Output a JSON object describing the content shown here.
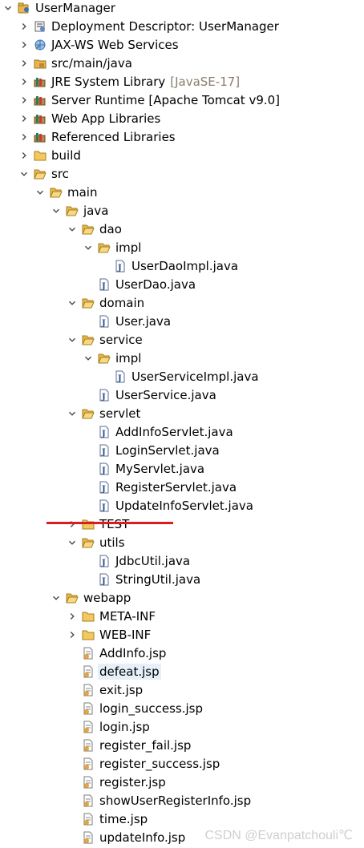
{
  "tree": [
    {
      "label": "UserManager",
      "level": 0,
      "twisty": "expanded",
      "icon": "project-icon"
    },
    {
      "label": "Deployment Descriptor: UserManager",
      "level": 1,
      "twisty": "collapsed",
      "icon": "deployment-descriptor-icon"
    },
    {
      "label": "JAX-WS Web Services",
      "level": 1,
      "twisty": "collapsed",
      "icon": "web-services-icon"
    },
    {
      "label": "src/main/java",
      "level": 1,
      "twisty": "collapsed",
      "icon": "source-folder-icon"
    },
    {
      "label": "JRE System Library",
      "decoration": "[JavaSE-17]",
      "level": 1,
      "twisty": "collapsed",
      "icon": "library-icon"
    },
    {
      "label": "Server Runtime [Apache Tomcat v9.0]",
      "level": 1,
      "twisty": "collapsed",
      "icon": "library-icon"
    },
    {
      "label": "Web App Libraries",
      "level": 1,
      "twisty": "collapsed",
      "icon": "library-icon"
    },
    {
      "label": "Referenced Libraries",
      "level": 1,
      "twisty": "collapsed",
      "icon": "library-icon"
    },
    {
      "label": "build",
      "level": 1,
      "twisty": "collapsed",
      "icon": "folder-icon"
    },
    {
      "label": "src",
      "level": 1,
      "twisty": "expanded",
      "icon": "folder-open-icon"
    },
    {
      "label": "main",
      "level": 2,
      "twisty": "expanded",
      "icon": "folder-open-icon"
    },
    {
      "label": "java",
      "level": 3,
      "twisty": "expanded",
      "icon": "folder-open-icon"
    },
    {
      "label": "dao",
      "level": 4,
      "twisty": "expanded",
      "icon": "folder-open-icon"
    },
    {
      "label": "impl",
      "level": 5,
      "twisty": "expanded",
      "icon": "folder-open-icon"
    },
    {
      "label": "UserDaoImpl.java",
      "level": 6,
      "twisty": "none",
      "icon": "java-file-icon"
    },
    {
      "label": "UserDao.java",
      "level": 5,
      "twisty": "none",
      "icon": "java-file-icon"
    },
    {
      "label": "domain",
      "level": 4,
      "twisty": "expanded",
      "icon": "folder-open-icon"
    },
    {
      "label": "User.java",
      "level": 5,
      "twisty": "none",
      "icon": "java-file-icon"
    },
    {
      "label": "service",
      "level": 4,
      "twisty": "expanded",
      "icon": "folder-open-icon"
    },
    {
      "label": "impl",
      "level": 5,
      "twisty": "expanded",
      "icon": "folder-open-icon"
    },
    {
      "label": "UserServiceImpl.java",
      "level": 6,
      "twisty": "none",
      "icon": "java-file-icon"
    },
    {
      "label": "UserService.java",
      "level": 5,
      "twisty": "none",
      "icon": "java-file-icon"
    },
    {
      "label": "servlet",
      "level": 4,
      "twisty": "expanded",
      "icon": "folder-open-icon"
    },
    {
      "label": "AddInfoServlet.java",
      "level": 5,
      "twisty": "none",
      "icon": "java-file-icon"
    },
    {
      "label": "LoginServlet.java",
      "level": 5,
      "twisty": "none",
      "icon": "java-file-icon"
    },
    {
      "label": "MyServlet.java",
      "level": 5,
      "twisty": "none",
      "icon": "java-file-icon"
    },
    {
      "label": "RegisterServlet.java",
      "level": 5,
      "twisty": "none",
      "icon": "java-file-icon"
    },
    {
      "label": "UpdateInfoServlet.java",
      "level": 5,
      "twisty": "none",
      "icon": "java-file-icon"
    },
    {
      "label": "TEST",
      "level": 4,
      "twisty": "collapsed",
      "icon": "folder-icon",
      "struck": true
    },
    {
      "label": "utils",
      "level": 4,
      "twisty": "expanded",
      "icon": "folder-open-icon"
    },
    {
      "label": "JdbcUtil.java",
      "level": 5,
      "twisty": "none",
      "icon": "java-file-icon"
    },
    {
      "label": "StringUtil.java",
      "level": 5,
      "twisty": "none",
      "icon": "java-file-icon"
    },
    {
      "label": "webapp",
      "level": 3,
      "twisty": "expanded",
      "icon": "folder-open-icon"
    },
    {
      "label": "META-INF",
      "level": 4,
      "twisty": "collapsed",
      "icon": "folder-icon"
    },
    {
      "label": "WEB-INF",
      "level": 4,
      "twisty": "collapsed",
      "icon": "folder-icon"
    },
    {
      "label": "AddInfo.jsp",
      "level": 4,
      "twisty": "none",
      "icon": "jsp-file-icon"
    },
    {
      "label": "defeat.jsp",
      "level": 4,
      "twisty": "none",
      "icon": "jsp-file-icon",
      "selected": true
    },
    {
      "label": "exit.jsp",
      "level": 4,
      "twisty": "none",
      "icon": "jsp-file-icon"
    },
    {
      "label": "login_success.jsp",
      "level": 4,
      "twisty": "none",
      "icon": "jsp-file-icon"
    },
    {
      "label": "login.jsp",
      "level": 4,
      "twisty": "none",
      "icon": "jsp-file-icon"
    },
    {
      "label": "register_fail.jsp",
      "level": 4,
      "twisty": "none",
      "icon": "jsp-file-icon"
    },
    {
      "label": "register_success.jsp",
      "level": 4,
      "twisty": "none",
      "icon": "jsp-file-icon"
    },
    {
      "label": "register.jsp",
      "level": 4,
      "twisty": "none",
      "icon": "jsp-file-icon"
    },
    {
      "label": "showUserRegisterInfo.jsp",
      "level": 4,
      "twisty": "none",
      "icon": "jsp-file-icon"
    },
    {
      "label": "time.jsp",
      "level": 4,
      "twisty": "none",
      "icon": "jsp-file-icon"
    },
    {
      "label": "updateInfo.jsp",
      "level": 4,
      "twisty": "none",
      "icon": "jsp-file-icon"
    }
  ],
  "watermark": "CSDN @Evanpatchouli℃",
  "colors": {
    "folder": "#e8b64a",
    "selection": "#e6f0fa",
    "annotation_line": "#d81e1e",
    "decoration_text": "#8b7d6b",
    "watermark": "#cfcfcf"
  }
}
